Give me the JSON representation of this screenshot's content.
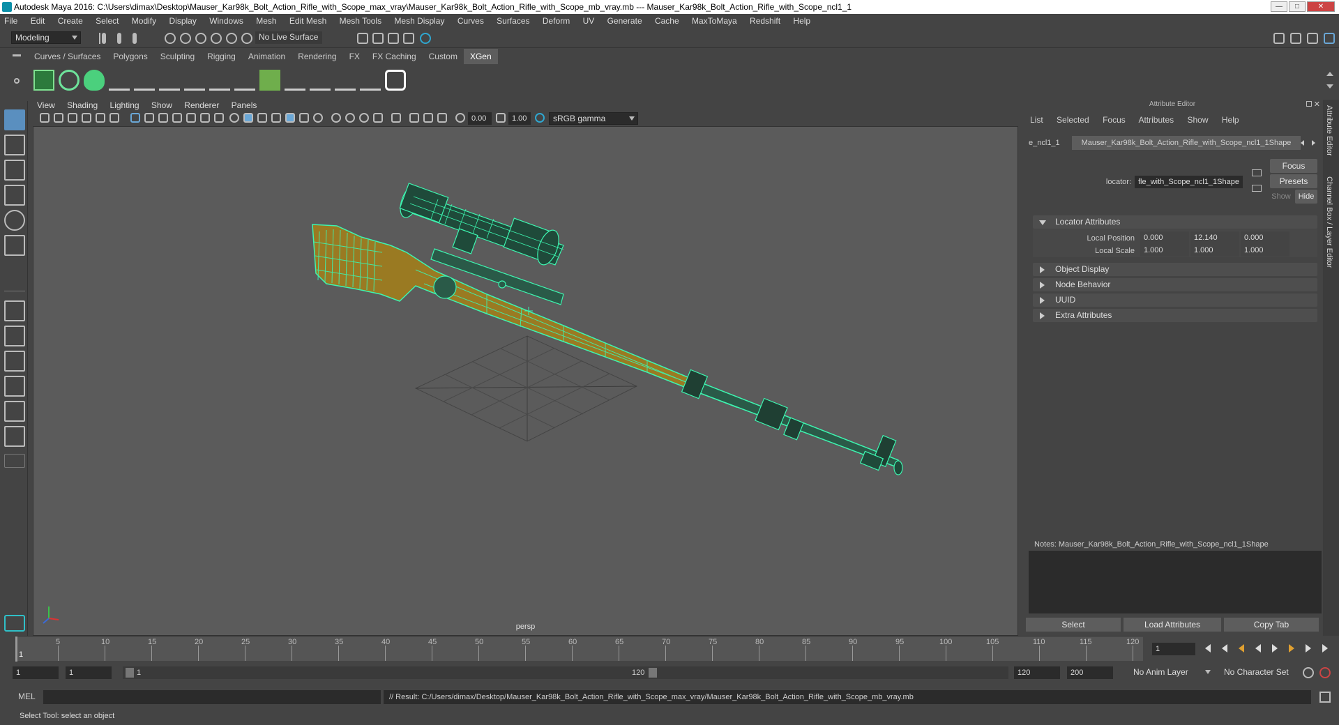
{
  "window": {
    "title": "Autodesk Maya 2016: C:\\Users\\dimax\\Desktop\\Mauser_Kar98k_Bolt_Action_Rifle_with_Scope_max_vray\\Mauser_Kar98k_Bolt_Action_Rifle_with_Scope_mb_vray.mb   ---   Mauser_Kar98k_Bolt_Action_Rifle_with_Scope_ncl1_1",
    "buttons": [
      "—",
      "□",
      "✕"
    ]
  },
  "menubar": [
    "File",
    "Edit",
    "Create",
    "Select",
    "Modify",
    "Display",
    "Windows",
    "Mesh",
    "Edit Mesh",
    "Mesh Tools",
    "Mesh Display",
    "Curves",
    "Surfaces",
    "Deform",
    "UV",
    "Generate",
    "Cache",
    "MaxToMaya",
    "Redshift",
    "Help"
  ],
  "status": {
    "mode": "Modeling",
    "live_surface": "No Live Surface"
  },
  "shelf_tabs": [
    "Curves / Surfaces",
    "Polygons",
    "Sculpting",
    "Rigging",
    "Animation",
    "Rendering",
    "FX",
    "FX Caching",
    "Custom",
    "XGen"
  ],
  "shelf_active": "XGen",
  "viewport": {
    "menus": [
      "View",
      "Shading",
      "Lighting",
      "Show",
      "Renderer",
      "Panels"
    ],
    "exposure": "0.00",
    "gamma": "1.00",
    "colorspace": "sRGB gamma",
    "camera": "persp"
  },
  "attribute_editor": {
    "title": "Attribute Editor",
    "menus": [
      "List",
      "Selected",
      "Focus",
      "Attributes",
      "Show",
      "Help"
    ],
    "tab_prev": "e_ncl1_1",
    "tab_active": "Mauser_Kar98k_Bolt_Action_Rifle_with_Scope_ncl1_1Shape",
    "locator_label": "locator:",
    "locator_value": "fle_with_Scope_ncl1_1Shape",
    "focus_btn": "Focus",
    "presets_btn": "Presets",
    "show_btn": "Show",
    "hide_btn": "Hide",
    "sections": [
      "Locator Attributes",
      "Object Display",
      "Node Behavior",
      "UUID",
      "Extra Attributes"
    ],
    "local_position_label": "Local Position",
    "local_position": [
      "0.000",
      "12.140",
      "0.000"
    ],
    "local_scale_label": "Local Scale",
    "local_scale": [
      "1.000",
      "1.000",
      "1.000"
    ],
    "notes": "Notes:  Mauser_Kar98k_Bolt_Action_Rifle_with_Scope_ncl1_1Shape",
    "select_btn": "Select",
    "load_btn": "Load Attributes",
    "copy_btn": "Copy Tab"
  },
  "side_tabs": [
    "Attribute Editor",
    "Channel Box / Layer Editor"
  ],
  "timeline": {
    "labels": [
      "5",
      "10",
      "15",
      "20",
      "25",
      "30",
      "35",
      "40",
      "45",
      "50",
      "55",
      "60",
      "65",
      "70",
      "75",
      "80",
      "85",
      "90",
      "95",
      "100",
      "105",
      "110",
      "115",
      "120"
    ],
    "start_marker": "1",
    "current_frame": "1"
  },
  "range": {
    "start": "1",
    "start2": "1",
    "slider_start": "1",
    "slider_end": "120",
    "end": "120",
    "end2": "200",
    "anim_layer": "No Anim Layer",
    "char_set": "No Character Set"
  },
  "cmdline": {
    "lang": "MEL",
    "result": "// Result: C:/Users/dimax/Desktop/Mauser_Kar98k_Bolt_Action_Rifle_with_Scope_max_vray/Mauser_Kar98k_Bolt_Action_Rifle_with_Scope_mb_vray.mb"
  },
  "help": "Select Tool: select an object",
  "colors": {
    "wire": "#3df5b0",
    "wood": "#9a7a22",
    "bg": "#5b5b5b"
  }
}
